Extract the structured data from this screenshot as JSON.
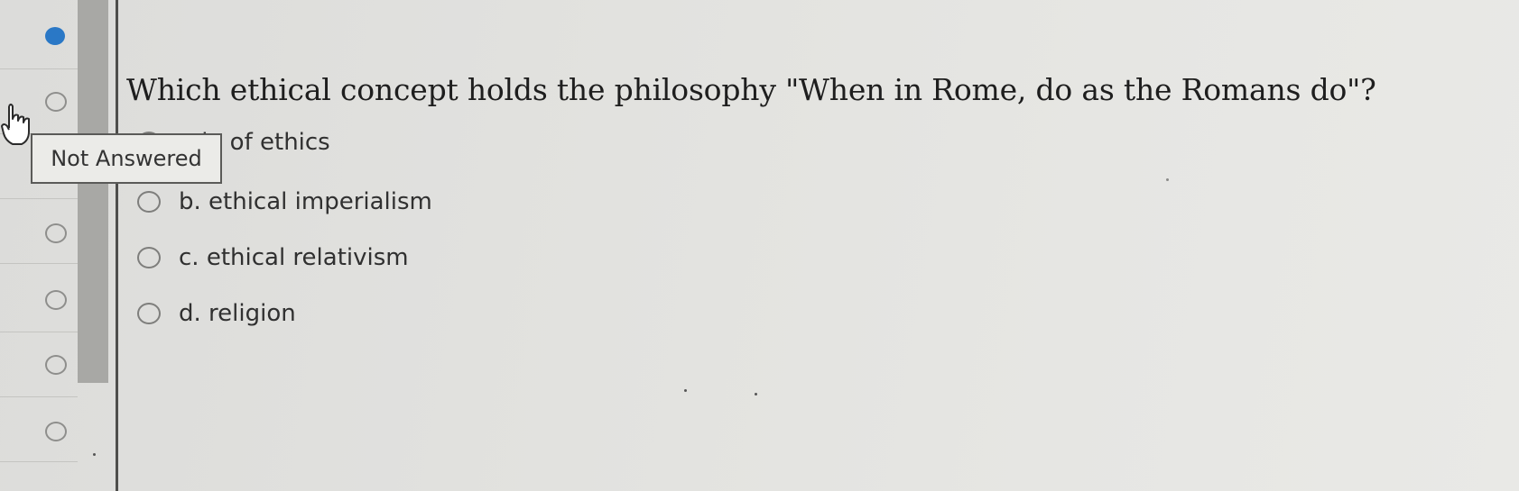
{
  "question": {
    "text": "Which ethical concept holds the philosophy \"When in Rome, do as the Romans do\"?"
  },
  "options": [
    {
      "label": "ode of ethics",
      "selected": false
    },
    {
      "label": "b. ethical imperialism",
      "selected": false
    },
    {
      "label": "c. ethical relativism",
      "selected": false
    },
    {
      "label": "d. religion",
      "selected": false
    }
  ],
  "tooltip": {
    "text": "Not Answered"
  },
  "nav": {
    "items": [
      {
        "state": "current"
      },
      {
        "state": "unanswered"
      },
      {
        "state": "unanswered"
      },
      {
        "state": "unanswered"
      },
      {
        "state": "unanswered"
      },
      {
        "state": "unanswered"
      },
      {
        "state": "unanswered"
      }
    ]
  },
  "colors": {
    "accent": "#2a78c6",
    "background": "#e2e2df",
    "scrollbar": "#a8a8a5"
  },
  "icons": {
    "cursor": "hand-pointer-icon",
    "radio": "radio-circle-icon"
  }
}
